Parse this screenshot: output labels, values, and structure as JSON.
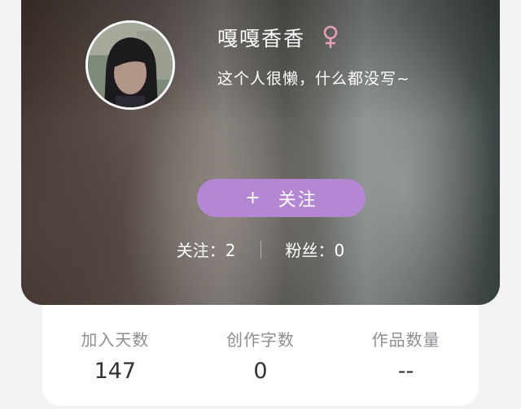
{
  "profile": {
    "username": "嘎嘎香香",
    "gender_icon": "female-icon",
    "bio": "这个人很懒，什么都没写~",
    "avatar": "avatar-photo",
    "accent_color": "#b487d3",
    "gender_color": "#e8a0b8"
  },
  "follow_button": {
    "icon": "+",
    "label": "关注"
  },
  "social": {
    "following": "关注：2",
    "followers": "粉丝：0"
  },
  "stats": [
    {
      "label": "加入天数",
      "value": "147"
    },
    {
      "label": "创作字数",
      "value": "0"
    },
    {
      "label": "作品数量",
      "value": "--"
    }
  ]
}
